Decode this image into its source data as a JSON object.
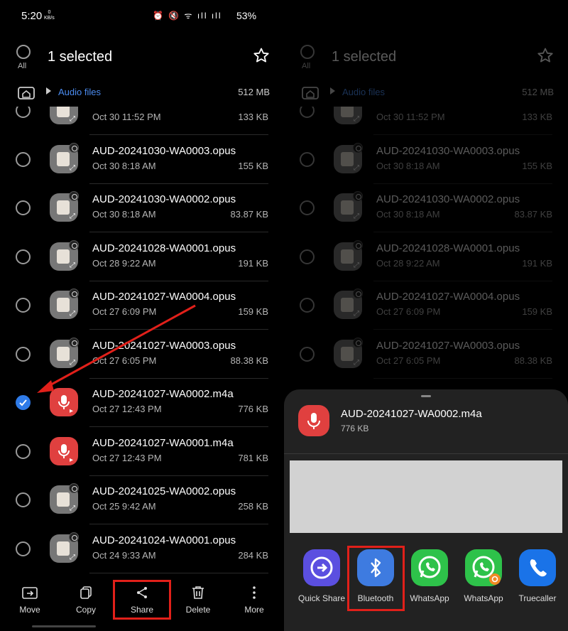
{
  "statusbar": {
    "time": "5:20",
    "speed": "0",
    "speed_unit": "KB/s",
    "battery": "53%"
  },
  "header": {
    "all_label": "All",
    "title": "1 selected",
    "title_dim": "1 selected"
  },
  "path": {
    "label": "Audio files",
    "size": "512 MB"
  },
  "files": [
    {
      "name": "",
      "date": "Oct 30 11:52 PM",
      "size": "133 KB",
      "type": "opus",
      "checked": false
    },
    {
      "name": "AUD-20241030-WA0003.opus",
      "date": "Oct 30 8:18 AM",
      "size": "155 KB",
      "type": "opus",
      "checked": false
    },
    {
      "name": "AUD-20241030-WA0002.opus",
      "date": "Oct 30 8:18 AM",
      "size": "83.87 KB",
      "type": "opus",
      "checked": false
    },
    {
      "name": "AUD-20241028-WA0001.opus",
      "date": "Oct 28 9:22 AM",
      "size": "191 KB",
      "type": "opus",
      "checked": false
    },
    {
      "name": "AUD-20241027-WA0004.opus",
      "date": "Oct 27 6:09 PM",
      "size": "159 KB",
      "type": "opus",
      "checked": false
    },
    {
      "name": "AUD-20241027-WA0003.opus",
      "date": "Oct 27 6:05 PM",
      "size": "88.38 KB",
      "type": "opus",
      "checked": false
    },
    {
      "name": "AUD-20241027-WA0002.m4a",
      "date": "Oct 27 12:43 PM",
      "size": "776 KB",
      "type": "m4a",
      "checked": true
    },
    {
      "name": "AUD-20241027-WA0001.m4a",
      "date": "Oct 27 12:43 PM",
      "size": "781 KB",
      "type": "m4a",
      "checked": false
    },
    {
      "name": "AUD-20241025-WA0002.opus",
      "date": "Oct 25 9:42 AM",
      "size": "258 KB",
      "type": "opus",
      "checked": false
    },
    {
      "name": "AUD-20241024-WA0001.opus",
      "date": "Oct 24 9:33 AM",
      "size": "284 KB",
      "type": "opus",
      "checked": false
    }
  ],
  "toolbar": {
    "move": "Move",
    "copy": "Copy",
    "share": "Share",
    "delete": "Delete",
    "more": "More"
  },
  "share_sheet": {
    "file_name": "AUD-20241027-WA0002.m4a",
    "file_size": "776 KB",
    "apps": [
      {
        "label": "Quick Share",
        "color": "#5b4fe0"
      },
      {
        "label": "Bluetooth",
        "color": "#3e7be0"
      },
      {
        "label": "WhatsApp",
        "color": "#2ec24a"
      },
      {
        "label": "WhatsApp",
        "color": "#2ec24a"
      },
      {
        "label": "Truecaller",
        "color": "#1a73e8"
      }
    ]
  },
  "colors": {
    "accent": "#2f7be8",
    "highlight": "#e1201a",
    "path": "#4b8cf0"
  }
}
